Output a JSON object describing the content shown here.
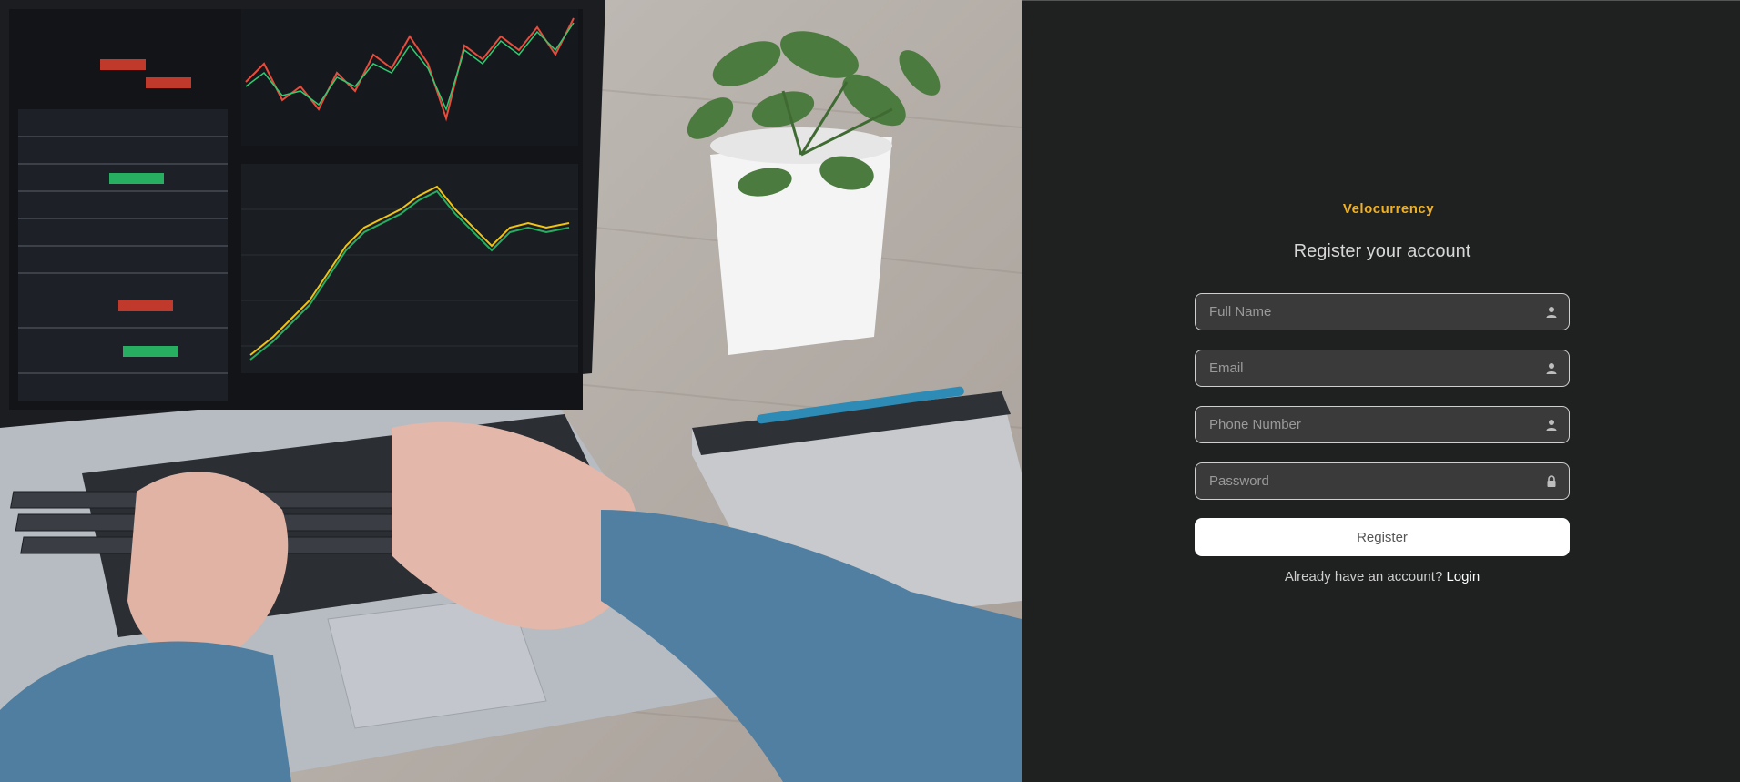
{
  "hero": {
    "scene": "laptop-trading-desk-photo"
  },
  "brand": {
    "name": "Velocurrency",
    "color": "#f0b021"
  },
  "form": {
    "heading": "Register your account",
    "fields": [
      {
        "placeholder": "Full Name",
        "icon": "user-icon",
        "type": "text"
      },
      {
        "placeholder": "Email",
        "icon": "user-icon",
        "type": "email"
      },
      {
        "placeholder": "Phone Number",
        "icon": "user-icon",
        "type": "tel"
      },
      {
        "placeholder": "Password",
        "icon": "lock-icon",
        "type": "password"
      }
    ],
    "submit_label": "Register",
    "footer_text": "Already have an account?",
    "login_link": "Login"
  },
  "colors": {
    "panel_bg": "#1f2120",
    "field_bg": "#3a3a3a",
    "button_bg": "#ffffff"
  }
}
